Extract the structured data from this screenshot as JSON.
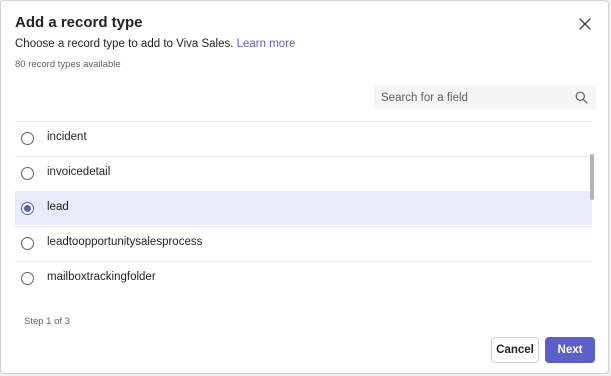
{
  "dialog": {
    "title": "Add a record type",
    "subtitle": "Choose a record type to add to Viva Sales.",
    "learn_more": "Learn more",
    "count_text": "80 record types available"
  },
  "search": {
    "placeholder": "Search for a field",
    "value": "",
    "icon": "search-icon"
  },
  "record_types": [
    {
      "label": "incident",
      "selected": false
    },
    {
      "label": "invoicedetail",
      "selected": false
    },
    {
      "label": "lead",
      "selected": true
    },
    {
      "label": "leadtoopportunitysalesprocess",
      "selected": false
    },
    {
      "label": "mailboxtrackingfolder",
      "selected": false
    }
  ],
  "footer": {
    "step_text": "Step 1 of 3",
    "cancel_label": "Cancel",
    "next_label": "Next"
  },
  "colors": {
    "accent": "#5b5fc7",
    "selected_row": "#e8ebfa"
  }
}
